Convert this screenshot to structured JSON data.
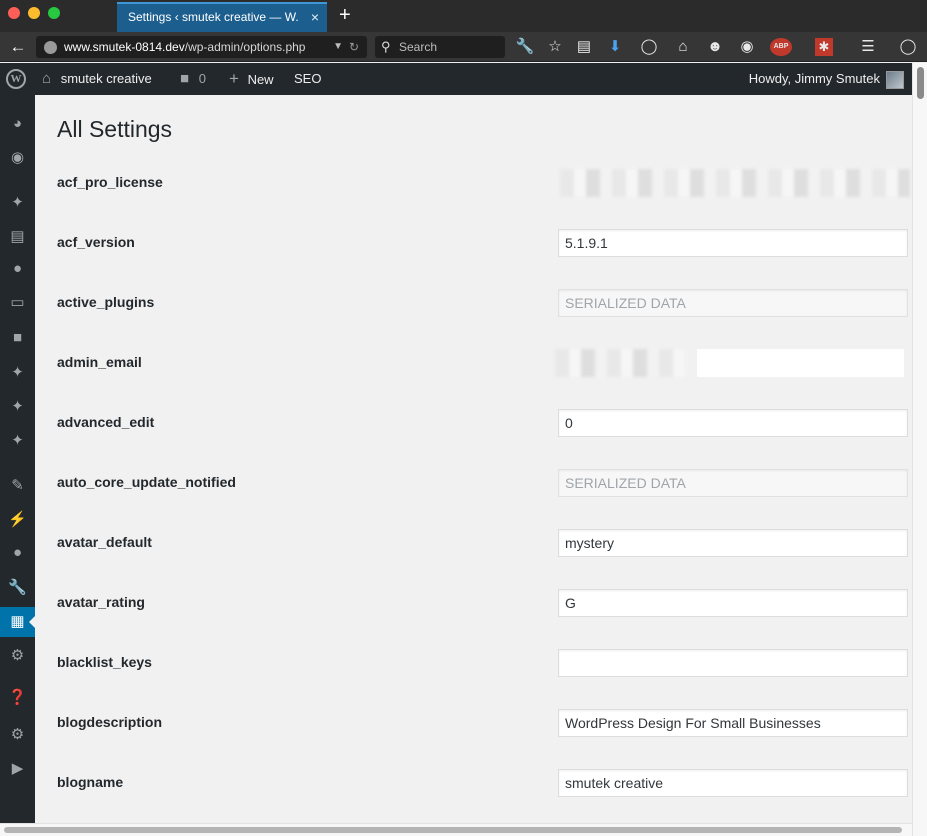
{
  "browser": {
    "tab_title": "Settings ‹ smutek creative — W...",
    "tab_close": "×",
    "new_tab": "+",
    "url_host": "www.smutek-0814.dev",
    "url_path": "/wp-admin/options.php",
    "search_placeholder": "Search",
    "toolbar_icons": [
      "wrench-icon",
      "star-icon",
      "reading-list-icon",
      "download-icon",
      "sync-icon",
      "home-icon",
      "chat-icon",
      "palette-icon",
      "adblock-icon",
      "lastpass-icon",
      "menu-icon",
      "extension-icon"
    ],
    "adblock_label": "ABP"
  },
  "adminbar": {
    "site_name": "smutek creative",
    "comments_count": "0",
    "new_label": "New",
    "seo_label": "SEO",
    "howdy": "Howdy, Jimmy Smutek"
  },
  "sidebar": {
    "items": [
      "dashboard-icon",
      "jetpack-icon",
      "posts-icon",
      "media-icon",
      "plugin-icon",
      "pages-icon",
      "comments-icon",
      "pin-icon",
      "pin-icon",
      "pin-icon",
      "tools-icon",
      "plugins-icon",
      "users-icon",
      "wrench-icon",
      "settings-current-icon",
      "gear-icon",
      "feedback-icon",
      "gear-icon",
      "play-icon"
    ]
  },
  "main": {
    "page_title": "All Settings",
    "settings": [
      {
        "name": "acf_pro_license",
        "value": "",
        "state": "blurred"
      },
      {
        "name": "acf_version",
        "value": "5.1.9.1",
        "state": "normal"
      },
      {
        "name": "active_plugins",
        "value": "SERIALIZED DATA",
        "state": "disabled"
      },
      {
        "name": "admin_email",
        "value": "",
        "state": "blurred"
      },
      {
        "name": "advanced_edit",
        "value": "0",
        "state": "normal"
      },
      {
        "name": "auto_core_update_notified",
        "value": "SERIALIZED DATA",
        "state": "disabled"
      },
      {
        "name": "avatar_default",
        "value": "mystery",
        "state": "normal"
      },
      {
        "name": "avatar_rating",
        "value": "G",
        "state": "normal"
      },
      {
        "name": "blacklist_keys",
        "value": "",
        "state": "normal"
      },
      {
        "name": "blogdescription",
        "value": "WordPress Design For Small Businesses",
        "state": "normal"
      },
      {
        "name": "blogname",
        "value": "smutek creative",
        "state": "normal"
      }
    ]
  }
}
